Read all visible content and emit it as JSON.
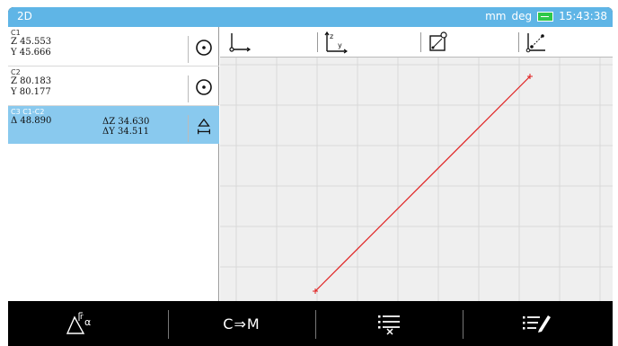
{
  "titlebar": {
    "title": "2D",
    "units_length": "mm",
    "units_angle": "deg",
    "time": "15:43:38"
  },
  "items": [
    {
      "name": "C1",
      "line1": "Z 45.553",
      "line2": "Y 45.666",
      "icon": "circle-dot-icon"
    },
    {
      "name": "C2",
      "line1": "Z 80.183",
      "line2": "Y 80.177",
      "icon": "circle-dot-icon"
    },
    {
      "name": "C3 C1-C2",
      "line1": "Δ 48.890",
      "delta_z": "ΔZ 34.630",
      "delta_y": "ΔY 34.511",
      "icon": "distance-icon",
      "selected": true
    }
  ],
  "toolbar": {
    "icons": [
      "axes-origin-icon",
      "axes-zy-icon",
      "zoom-fit-icon",
      "zoom-points-icon"
    ],
    "axis_z": "z",
    "axis_y": "y"
  },
  "plot": {
    "grid": true,
    "line_color": "#e02020"
  },
  "bottombar": {
    "buttons": [
      "angle-radius-icon",
      "C⇒M",
      "list-delete-icon",
      "list-edit-icon"
    ],
    "cm_label": "C⇒M"
  },
  "colors": {
    "titlebar": "#5fb5e6",
    "selected_row": "#89c9ee",
    "battery": "#2ec84a"
  }
}
